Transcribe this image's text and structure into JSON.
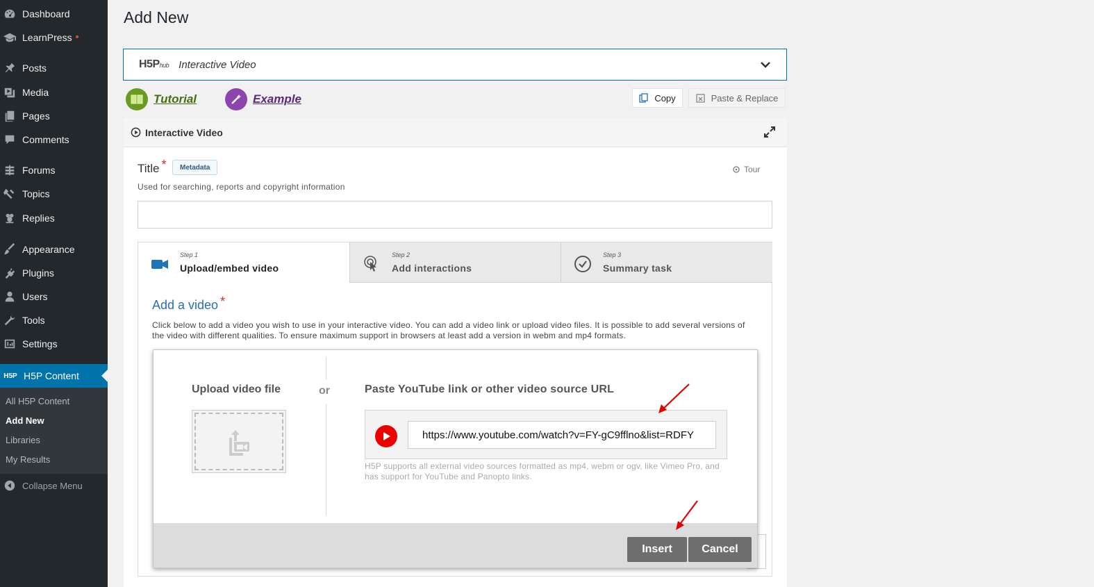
{
  "sidebar": {
    "items": [
      {
        "id": "dashboard",
        "label": "Dashboard",
        "icon": "dashboard-icon"
      },
      {
        "id": "learnpress",
        "label": "LearnPress",
        "icon": "graduation-cap-icon"
      },
      {
        "id": "posts",
        "label": "Posts",
        "icon": "pin-icon"
      },
      {
        "id": "media",
        "label": "Media",
        "icon": "media-icon"
      },
      {
        "id": "pages",
        "label": "Pages",
        "icon": "pages-icon"
      },
      {
        "id": "comments",
        "label": "Comments",
        "icon": "comment-icon"
      },
      {
        "id": "forums",
        "label": "Forums",
        "icon": "forums-icon"
      },
      {
        "id": "topics",
        "label": "Topics",
        "icon": "topics-icon"
      },
      {
        "id": "replies",
        "label": "Replies",
        "icon": "replies-icon"
      },
      {
        "id": "appearance",
        "label": "Appearance",
        "icon": "paintbrush-icon"
      },
      {
        "id": "plugins",
        "label": "Plugins",
        "icon": "plugin-icon"
      },
      {
        "id": "users",
        "label": "Users",
        "icon": "user-icon"
      },
      {
        "id": "tools",
        "label": "Tools",
        "icon": "wrench-icon"
      },
      {
        "id": "settings",
        "label": "Settings",
        "icon": "settings-icon"
      },
      {
        "id": "h5p",
        "label": "H5P Content",
        "icon": "h5p-icon"
      }
    ],
    "submenu": [
      "All H5P Content",
      "Add New",
      "Libraries",
      "My Results"
    ],
    "collapse_label": "Collapse Menu"
  },
  "page": {
    "title": "Add New"
  },
  "hub": {
    "logo_main": "H5P",
    "logo_sub": "hub",
    "content_type": "Interactive Video",
    "tutorial_label": "Tutorial",
    "example_label": "Example",
    "copy_label": "Copy",
    "paste_label": "Paste & Replace"
  },
  "editor": {
    "header_title": "Interactive Video",
    "title_label": "Title",
    "required_mark": "*",
    "metadata_label": "Metadata",
    "tour_label": "Tour",
    "title_description": "Used for searching, reports and copyright information",
    "title_value": ""
  },
  "steps": [
    {
      "step": "Step 1",
      "name": "Upload/embed video",
      "icon": "video-camera-icon"
    },
    {
      "step": "Step 2",
      "name": "Add interactions",
      "icon": "touch-icon"
    },
    {
      "step": "Step 3",
      "name": "Summary task",
      "icon": "check-circle-icon"
    }
  ],
  "video": {
    "heading": "Add a video",
    "description": "Click below to add a video you wish to use in your interactive video. You can add a video link or upload video files. It is possible to add several versions of the video with different qualities. To ensure maximum support in browsers at least add a version in webm and mp4 formats."
  },
  "dialog": {
    "upload_label": "Upload video file",
    "or_label": "or",
    "paste_label": "Paste YouTube link or other video source URL",
    "url_value": "https://www.youtube.com/watch?v=FY-gC9fflno&list=RDFY",
    "help_text": "H5P supports all external video sources formatted as mp4, webm or ogv, like Vimeo Pro, and has support for YouTube and Panopto links.",
    "insert_label": "Insert",
    "cancel_label": "Cancel"
  },
  "colors": {
    "sidebar_bg": "#23282d",
    "active_blue": "#0073aa",
    "tutorial_green": "#6a9a1f",
    "example_purple": "#8e44ad",
    "youtube_red": "#ee0000",
    "annotation_red": "#e00000"
  }
}
